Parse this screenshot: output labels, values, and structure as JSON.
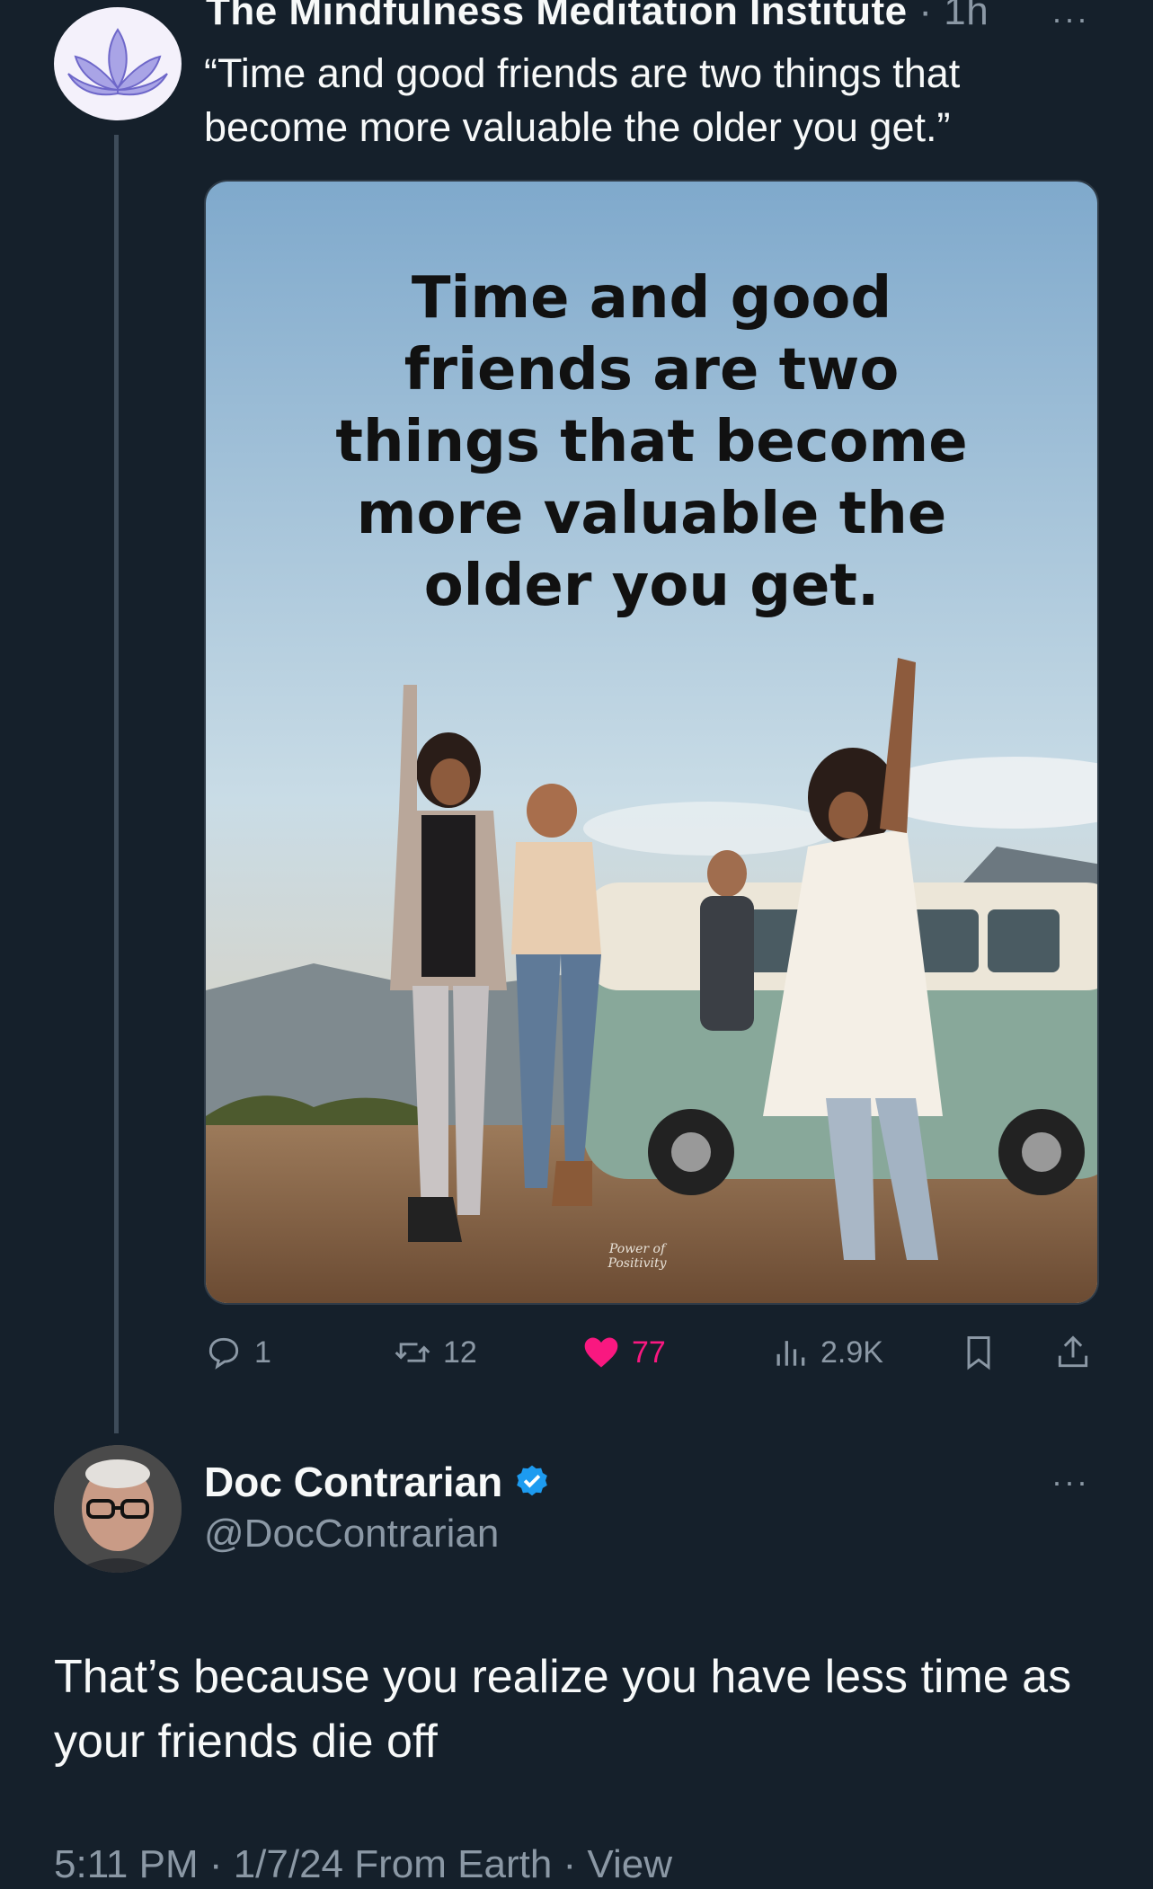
{
  "original_tweet": {
    "author_name": "The Mindfulness Meditation Institute",
    "meta": " · 1h",
    "more": "···",
    "text": "“Time and good friends are two things that become more valuable the older you get.”",
    "image_quote": "Time and good friends are two things that become more valuable the older you get.",
    "image_watermark": "Power of Positivity",
    "avatar_icon": "lotus-icon",
    "actions": {
      "replies": "1",
      "retweets": "12",
      "likes": "77",
      "views": "2.9K"
    }
  },
  "reply": {
    "author_name": "Doc Contrarian",
    "handle": "@DocContrarian",
    "more": "···",
    "verified_icon": "verified-badge-icon",
    "text": "That’s because you realize you have less time as your friends die off",
    "footer": "5:11 PM · 1/7/24 From Earth · View"
  },
  "colors": {
    "background": "#15202b",
    "text": "#f7f9f9",
    "muted": "#8b98a5",
    "like": "#f91880",
    "verified": "#1d9bf0"
  }
}
